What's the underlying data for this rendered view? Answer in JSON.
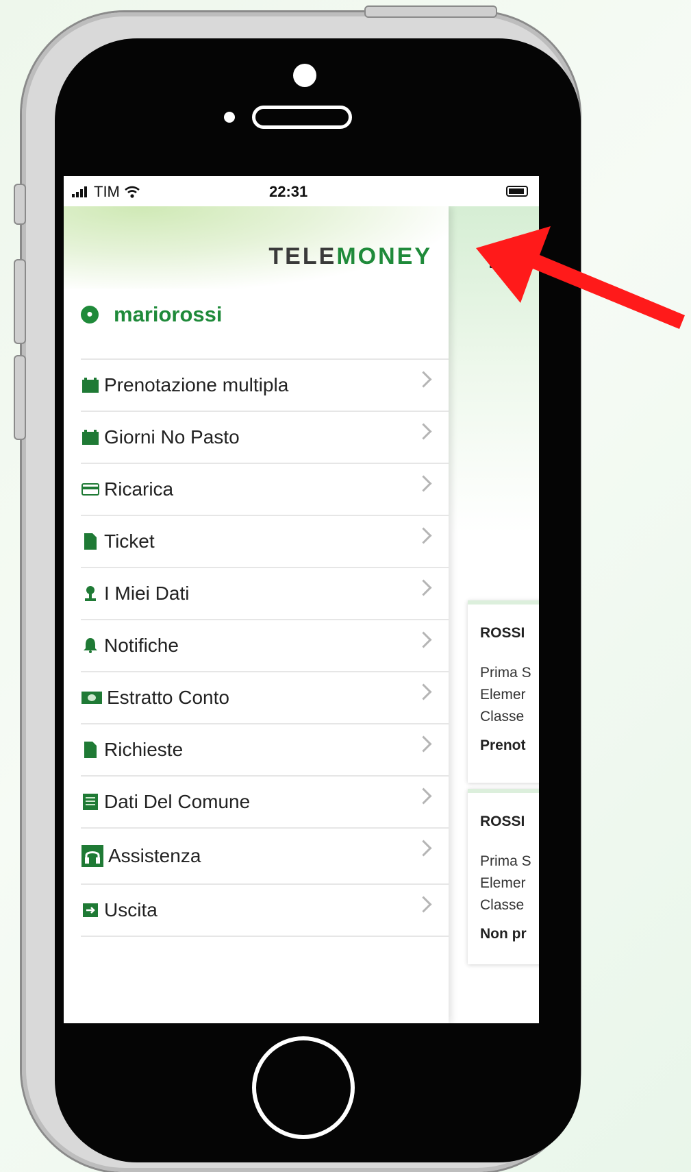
{
  "status_bar": {
    "carrier": "TIM",
    "time": "22:31"
  },
  "brand": {
    "logo_part1": "TELE",
    "logo_part2": "MONEY",
    "accent": "#1f8a3a"
  },
  "user": {
    "username": "mariorossi"
  },
  "menu": [
    {
      "label": "Prenotazione multipla",
      "icon": "calendar-icon"
    },
    {
      "label": "Giorni No Pasto",
      "icon": "calendar-icon"
    },
    {
      "label": "Ricarica",
      "icon": "credit-card-icon"
    },
    {
      "label": "Ticket",
      "icon": "document-icon"
    },
    {
      "label": "I Miei Dati",
      "icon": "user-icon"
    },
    {
      "label": "Notifiche",
      "icon": "bell-icon"
    },
    {
      "label": "Estratto Conto",
      "icon": "money-icon"
    },
    {
      "label": "Richieste",
      "icon": "document-icon"
    },
    {
      "label": "Dati Del Comune",
      "icon": "book-icon"
    },
    {
      "label": "Assistenza",
      "icon": "headset-icon"
    },
    {
      "label": "Uscita",
      "icon": "exit-icon"
    }
  ],
  "background_cards": [
    {
      "name": "ROSSI",
      "line1": "Prima S",
      "line2": "Elemer",
      "line3": "Classe",
      "status": "Prenot"
    },
    {
      "name": "ROSSI",
      "line1": "Prima S",
      "line2": "Elemer",
      "line3": "Classe",
      "status": "Non pr"
    }
  ],
  "annotation": {
    "color": "#ff1a1a"
  }
}
